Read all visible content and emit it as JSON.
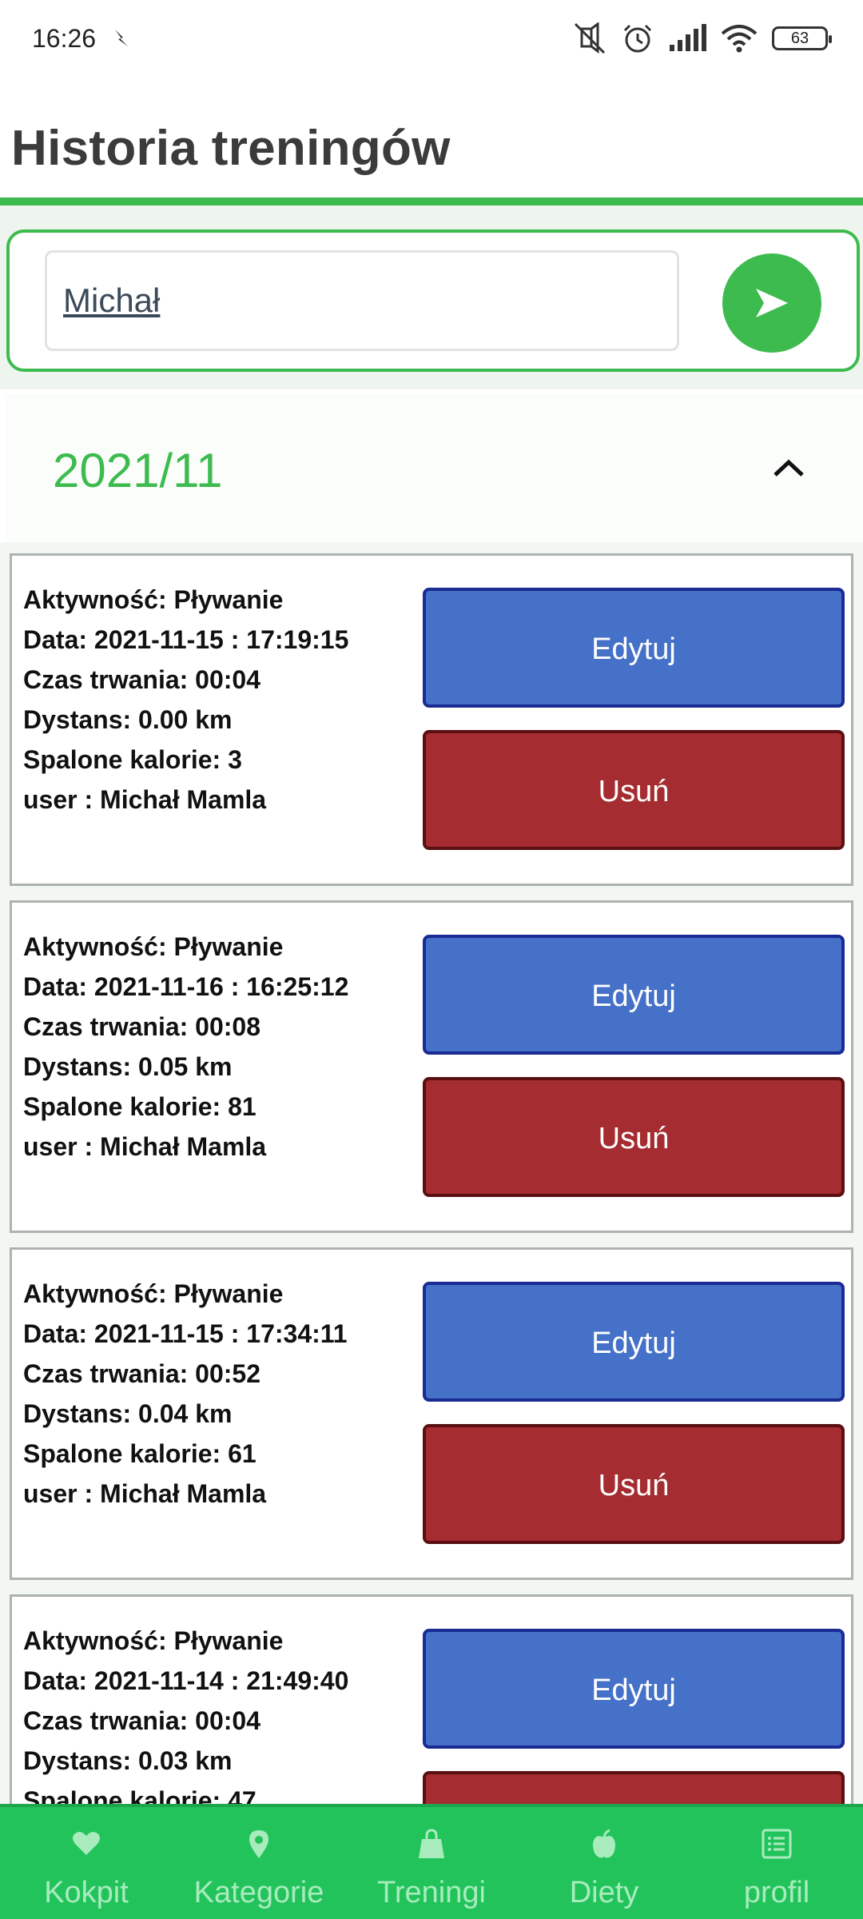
{
  "status_bar": {
    "time": "16:26",
    "battery": "63"
  },
  "header": {
    "title": "Historia treningów"
  },
  "search": {
    "value": "Michał"
  },
  "month": {
    "label": "2021/11"
  },
  "workouts": [
    {
      "activity": "Aktywność: Pływanie",
      "date": "Data: 2021-11-15 : 17:19:15",
      "duration": "Czas trwania: 00:04",
      "distance": "Dystans: 0.00 km",
      "calories": "Spalone kalorie: 3",
      "user": "user : Michał Mamla",
      "edit_label": "Edytuj",
      "delete_label": "Usuń"
    },
    {
      "activity": "Aktywność: Pływanie",
      "date": "Data: 2021-11-16 : 16:25:12",
      "duration": "Czas trwania: 00:08",
      "distance": "Dystans: 0.05 km",
      "calories": "Spalone kalorie: 81",
      "user": "user : Michał Mamla",
      "edit_label": "Edytuj",
      "delete_label": "Usuń"
    },
    {
      "activity": "Aktywność: Pływanie",
      "date": "Data: 2021-11-15 : 17:34:11",
      "duration": "Czas trwania: 00:52",
      "distance": "Dystans: 0.04 km",
      "calories": "Spalone kalorie: 61",
      "user": "user : Michał Mamla",
      "edit_label": "Edytuj",
      "delete_label": "Usuń"
    },
    {
      "activity": "Aktywność: Pływanie",
      "date": "Data: 2021-11-14 : 21:49:40",
      "duration": "Czas trwania: 00:04",
      "distance": "Dystans: 0.03 km",
      "calories": "Spalone kalorie: 47",
      "user": "",
      "edit_label": "Edytuj",
      "delete_label": ""
    }
  ],
  "bottom_nav": [
    {
      "label": "Kokpit",
      "icon": "heart-icon"
    },
    {
      "label": "Kategorie",
      "icon": "map-pin-icon"
    },
    {
      "label": "Treningi",
      "icon": "shopping-bag-icon"
    },
    {
      "label": "Diety",
      "icon": "apple-icon"
    },
    {
      "label": "profil",
      "icon": "list-icon"
    }
  ],
  "colors": {
    "accent_green": "#3dbb4f",
    "nav_green": "#23c35c",
    "edit_blue": "#4671c8",
    "delete_red": "#a52c30"
  }
}
